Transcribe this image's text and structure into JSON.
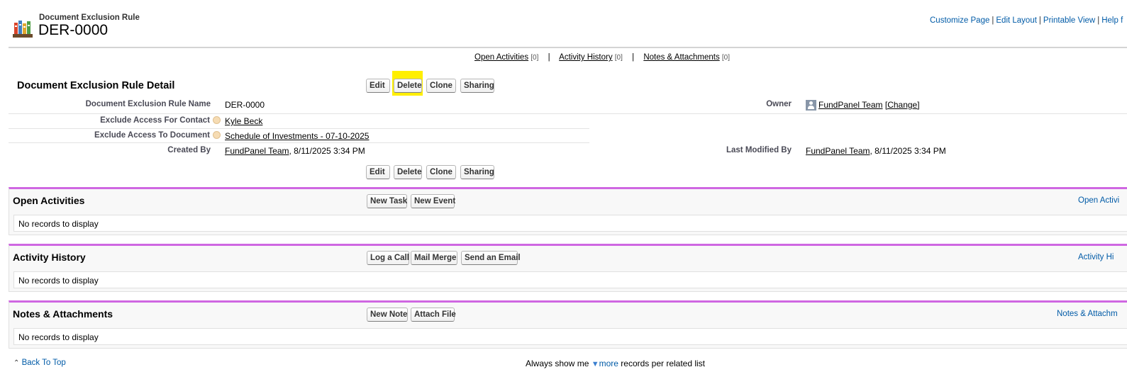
{
  "header": {
    "object_label": "Document Exclusion Rule",
    "record_name": "DER-0000",
    "links": [
      "Customize Page",
      "Edit Layout",
      "Printable View",
      "Help f"
    ]
  },
  "hover_links": [
    {
      "label": "Open Activities",
      "count": "[0]"
    },
    {
      "label": "Activity History",
      "count": "[0]"
    },
    {
      "label": "Notes & Attachments",
      "count": "[0]"
    }
  ],
  "detail": {
    "title": "Document Exclusion Rule Detail",
    "buttons": [
      "Edit",
      "Delete",
      "Clone",
      "Sharing"
    ],
    "fields": {
      "name_label": "Document Exclusion Rule Name",
      "name_value": "DER-0000",
      "owner_label": "Owner",
      "owner_value": "FundPanel Team",
      "owner_change": "[Change]",
      "contact_label": "Exclude Access For Contact",
      "contact_value": "Kyle Beck",
      "document_label": "Exclude Access To Document",
      "document_value": "Schedule of Investments - 07-10-2025",
      "created_label": "Created By",
      "created_user": "FundPanel Team",
      "created_date": ", 8/11/2025 3:34 PM",
      "modified_label": "Last Modified By",
      "modified_user": "FundPanel Team",
      "modified_date": ", 8/11/2025 3:34 PM"
    }
  },
  "related": {
    "open_activities": {
      "title": "Open Activities",
      "buttons": [
        "New Task",
        "New Event"
      ],
      "empty": "No records to display",
      "help": "Open Activi"
    },
    "activity_history": {
      "title": "Activity History",
      "buttons": [
        "Log a Call",
        "Mail Merge",
        "Send an Email"
      ],
      "empty": "No records to display",
      "help": "Activity Hi"
    },
    "notes": {
      "title": "Notes & Attachments",
      "buttons": [
        "New Note",
        "Attach File"
      ],
      "empty": "No records to display",
      "help": "Notes & Attachm"
    }
  },
  "footer": {
    "back_to_top": "Back To Top",
    "show_prefix": "Always show me",
    "show_more": "more",
    "show_suffix": "records per related list"
  },
  "colors": {
    "accent": "#cf67e2",
    "link": "#015ba7",
    "highlight": "#ffef00"
  }
}
